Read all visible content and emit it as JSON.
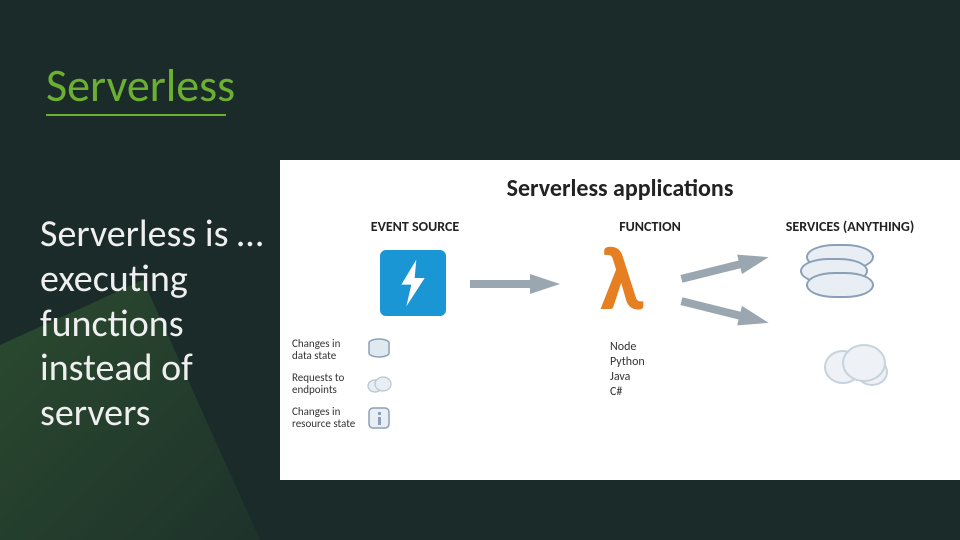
{
  "slide": {
    "title": "Serverless",
    "subtitle": "Serverless is …\nexecuting\nfunctions\ninstead of\nservers"
  },
  "diagram": {
    "title": "Serverless applications",
    "columns": {
      "event_source": "EVENT SOURCE",
      "function": "FUNCTION",
      "services": "SERVICES (ANYTHING)"
    },
    "event_rows": [
      {
        "label": "Changes in data state",
        "icon": "database-icon"
      },
      {
        "label": "Requests to endpoints",
        "icon": "cloud-icon"
      },
      {
        "label": "Changes in resource state",
        "icon": "info-icon"
      }
    ],
    "lambda_symbol": "λ",
    "languages": [
      "Node",
      "Python",
      "Java",
      "C#"
    ],
    "event_source_color": "#1a96d4",
    "lambda_color": "#e67e22"
  }
}
